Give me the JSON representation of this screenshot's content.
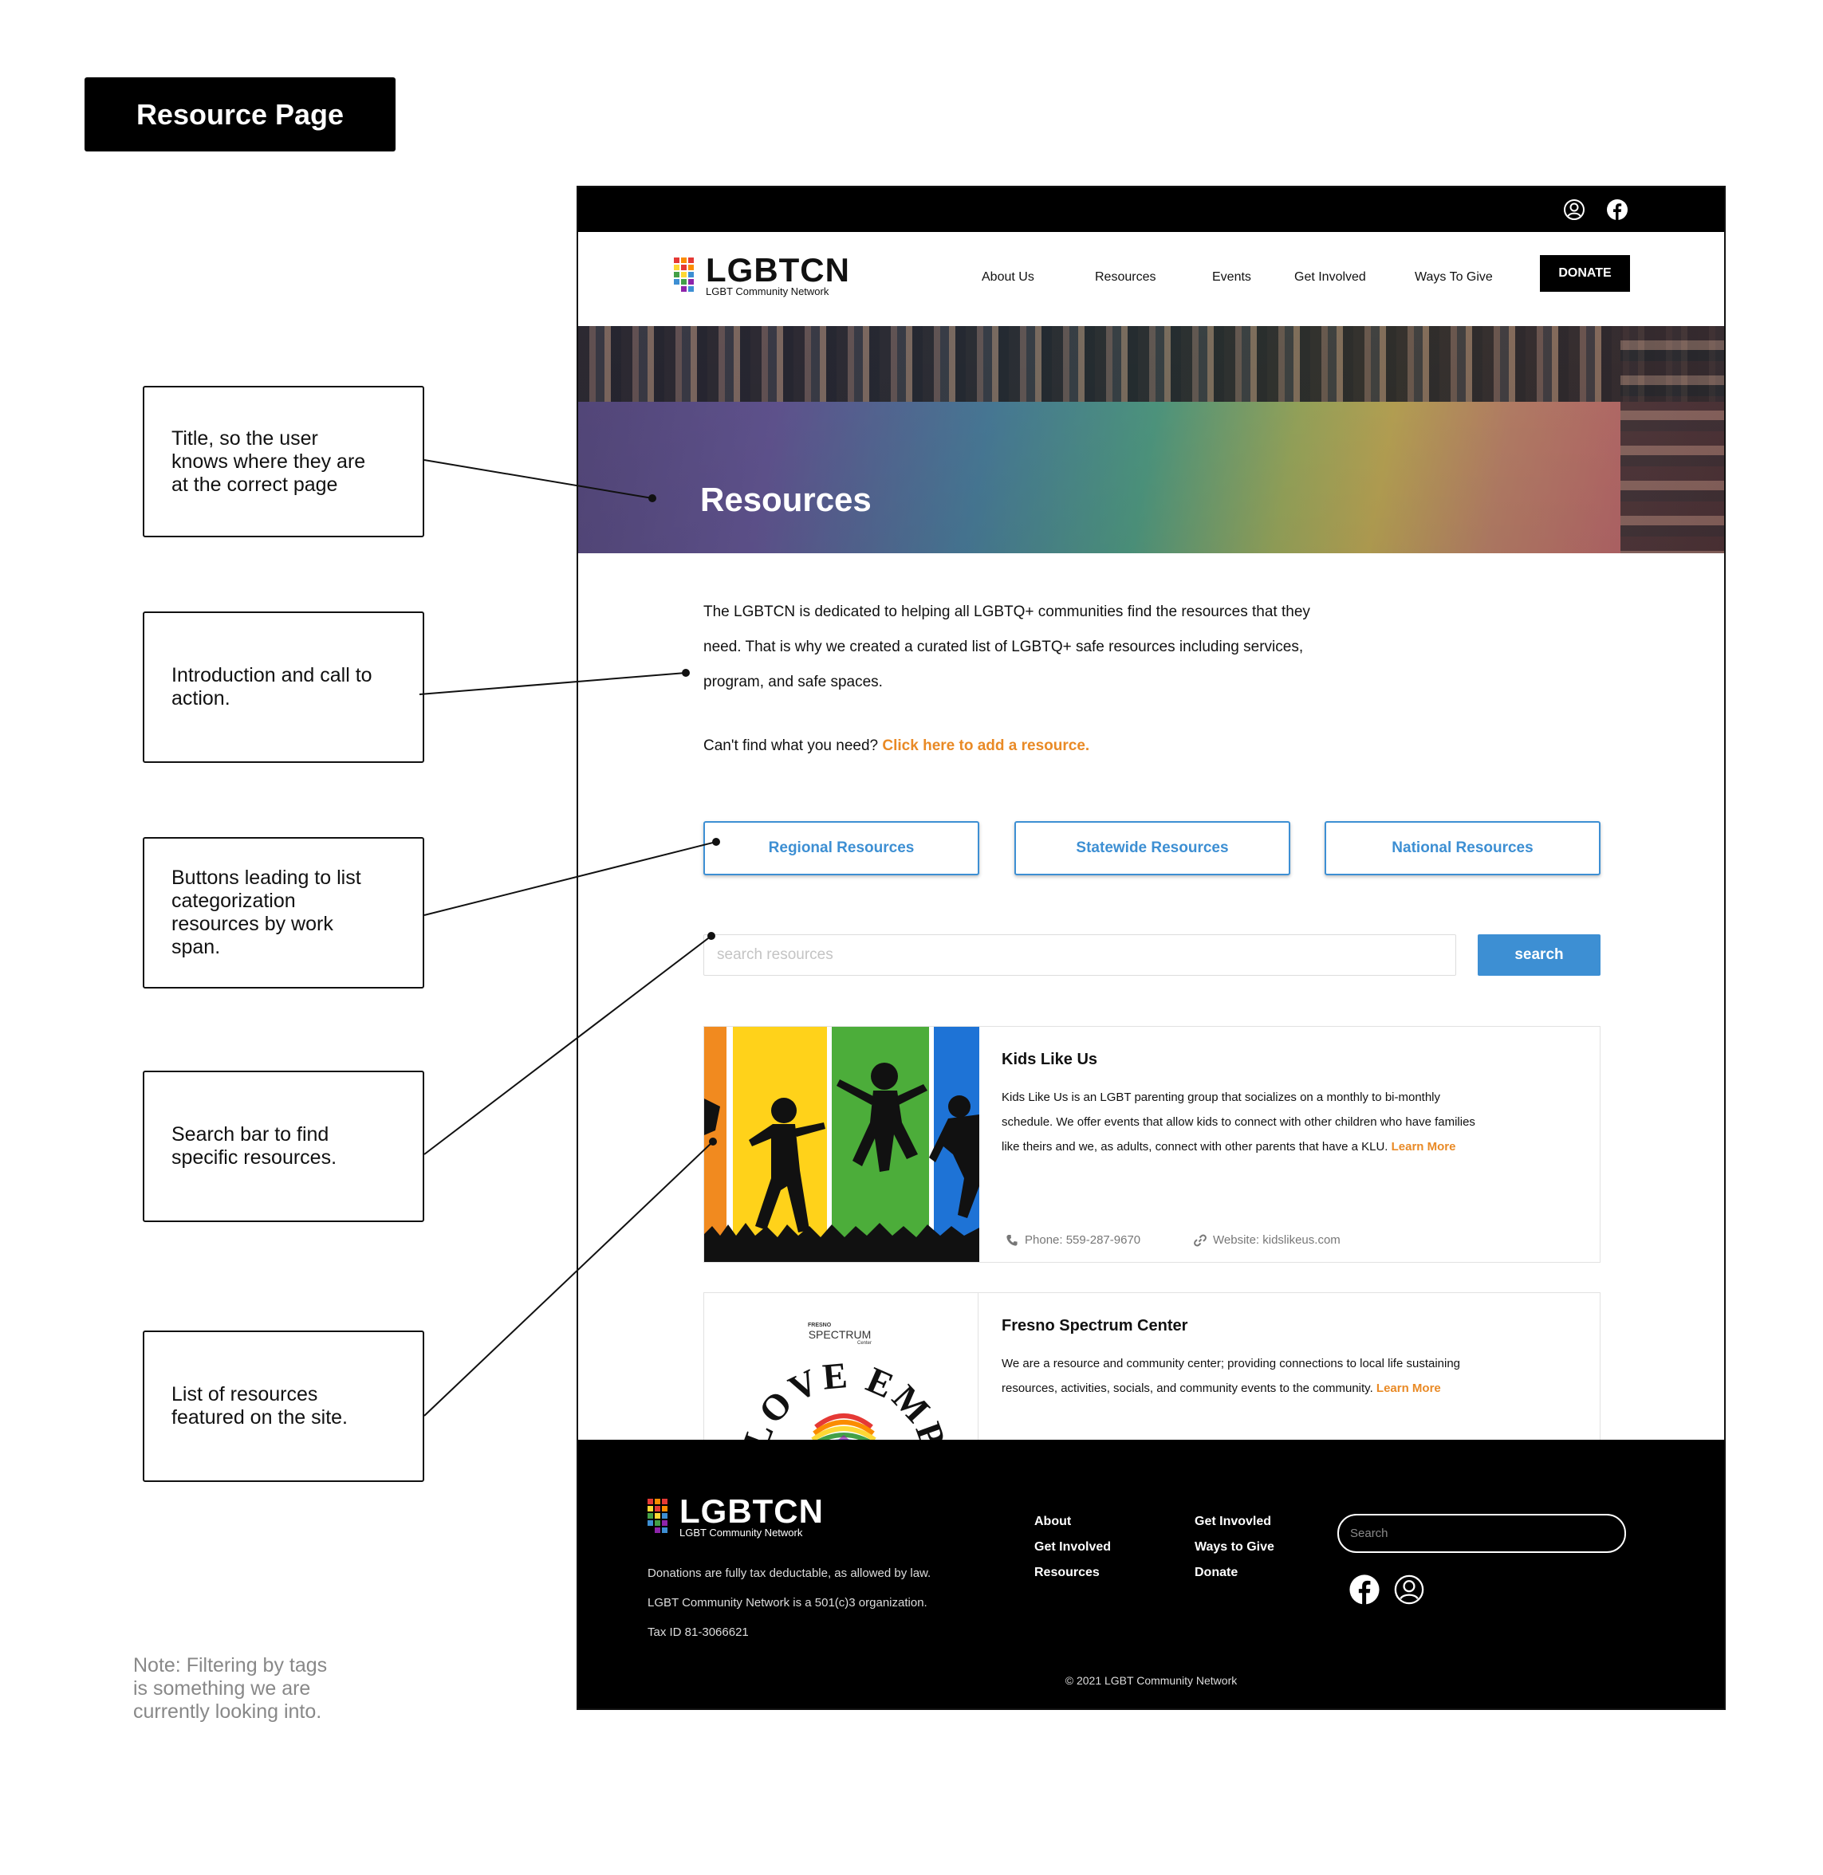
{
  "badge": {
    "label": "Resource Page"
  },
  "annotations": [
    "Title, so the user\nknows where they are\nat the correct page",
    "Introduction and call to\naction.",
    "Buttons leading to list\ncategorization\nresources by work\nspan.",
    "Search bar to find\nspecific resources.",
    "List of resources\nfeatured on the site."
  ],
  "note": "Note: Filtering by tags\nis something we are\ncurrently looking into.",
  "site": {
    "logo": {
      "name": "LGBTCN",
      "tagline": "LGBT Community Network"
    },
    "nav": [
      "About Us",
      "Resources",
      "Events",
      "Get Involved",
      "Ways To Give"
    ],
    "donate_label": "DONATE",
    "hero_title": "Resources",
    "intro": "The LGBTCN is dedicated to helping all LGBTQ+ communities find the resources that they need. That is why we created a curated list of LGBTQ+ safe resources including services, program, and safe spaces.",
    "cta_prefix": "Can't find what you need?",
    "cta_link": "Click here to add a resource.",
    "categories": [
      "Regional Resources",
      "Statewide Resources",
      "National Resources"
    ],
    "search_placeholder": "search resources",
    "search_button": "search",
    "cards": [
      {
        "title": "Kids Like Us",
        "desc": "Kids Like Us is an LGBT parenting group that socializes on a monthly to bi-monthly schedule. We offer events that allow kids to connect with other children who have families like theirs and we, as adults, connect with other parents that have a KLU.",
        "learn_more": "Learn More",
        "phone": "Phone: 559-287-9670",
        "website": "Website: kidslikeus.com"
      },
      {
        "title": "Fresno Spectrum Center",
        "desc": "We are a resource and community center; providing connections to local life sustaining resources, activities, socials, and community events to the community.",
        "learn_more": "Learn More",
        "logo_top": "FRESNO",
        "logo_mid": "SPECTRUM",
        "logo_bot": "Center",
        "logo_arc": "LOVE EMPO"
      }
    ],
    "footer": {
      "lines": [
        "Donations are fully tax deductable, as allowed by law.",
        "LGBT Community Network is a 501(c)3 organization.",
        "Tax ID 81-3066621"
      ],
      "col1": [
        "About",
        "Get Involved",
        "Resources"
      ],
      "col2": [
        "Get Invovled",
        "Ways to Give",
        "Donate"
      ],
      "search_placeholder": "Search",
      "copyright": "© 2021 LGBT Community Network"
    },
    "colors": {
      "accent_blue": "#3d8fd3",
      "accent_orange": "#e98a26"
    },
    "icons": [
      "user-icon",
      "facebook-icon",
      "phone-icon",
      "link-icon"
    ]
  }
}
